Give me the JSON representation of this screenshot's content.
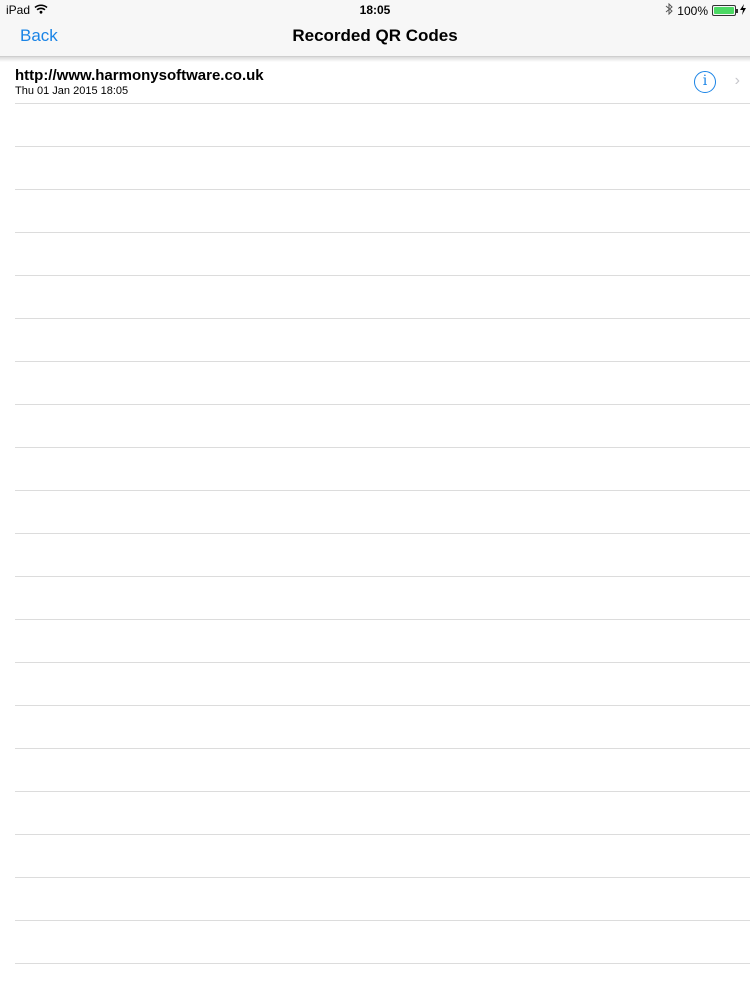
{
  "status_bar": {
    "device": "iPad",
    "time": "18:05",
    "battery": "100%",
    "battery_level": 1.0
  },
  "nav": {
    "back_label": "Back",
    "title": "Recorded QR Codes"
  },
  "list": {
    "items": [
      {
        "title": "http://www.harmonysoftware.co.uk",
        "subtitle": "Thu 01 Jan 2015 18:05"
      }
    ]
  },
  "icons": {
    "wifi": "wifi-icon",
    "bluetooth": "bluetooth-icon",
    "battery": "battery-icon",
    "charging": "charging-icon",
    "info": "info-icon",
    "chevron": "chevron-right-icon"
  },
  "colors": {
    "accent": "#1a84e6",
    "battery_fill": "#4cd964"
  }
}
